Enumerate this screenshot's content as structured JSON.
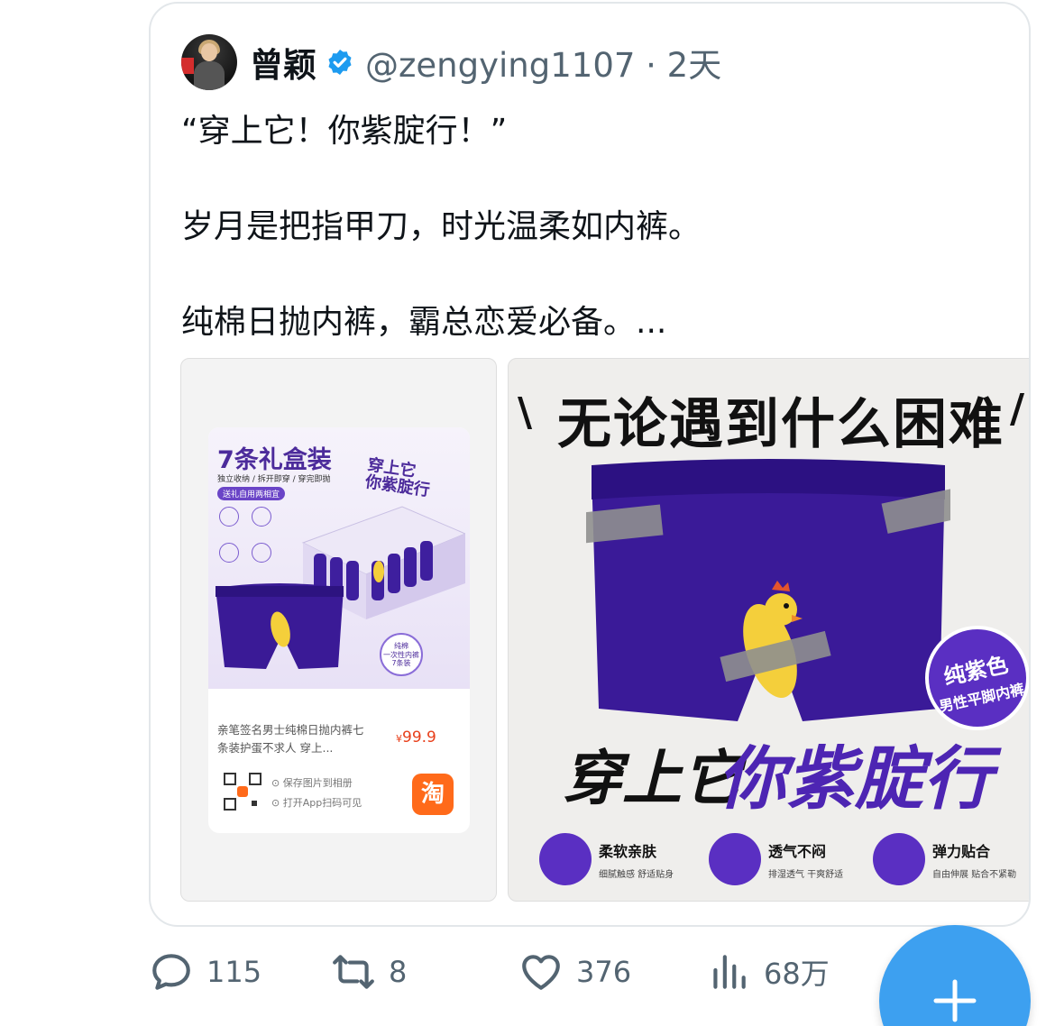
{
  "tweet": {
    "author_name": "曾颖",
    "handle_time": "@zengying1107 · 2天",
    "line1": "“穿上它！你紫腚行！”",
    "line2": "岁月是把指甲刀，时光温柔如内裤。",
    "line3": "纯棉日抛内裤，霸总恋爱必备。..."
  },
  "left_image": {
    "title": "7条礼盒装",
    "subtitle": "独立收纳 / 拆开即穿 / 穿完即抛",
    "tag": "送礼自用两相宜",
    "slogan": "穿上它\n你紫腚行",
    "round_badge": "纯棉\n一次性内裤\n7条装",
    "description": "亲笔签名男士纯棉日抛内裤七条装护蛋不求人 穿上...",
    "price_symbol": "¥",
    "price": "99.9",
    "save_text": "保存图片到相册",
    "scan_text": "打开App扫码可见",
    "app_icon": "淘"
  },
  "right_image": {
    "headline": "无论遇到什么困难",
    "badge_line1": "纯紫色",
    "badge_line2": "男性平脚内裤",
    "slogan_black": "穿上它",
    "slogan_purple": "你紫腚行",
    "features": [
      {
        "title": "柔软亲肤",
        "desc": "细腻触感 舒适贴身",
        "icon": "cloud-icon"
      },
      {
        "title": "透气不闷",
        "desc": "排湿透气 干爽舒适",
        "icon": "airflow-icon"
      },
      {
        "title": "弹力贴合",
        "desc": "自由伸展 贴合不紧勒",
        "icon": "stretch-icon"
      }
    ],
    "accent_color": "#4d25b3"
  },
  "actions": {
    "replies": "115",
    "retweets": "8",
    "likes": "376",
    "views": "68万"
  },
  "colors": {
    "verified": "#1d9bf0",
    "fab": "#3da0f0",
    "muted_text": "#536471"
  }
}
